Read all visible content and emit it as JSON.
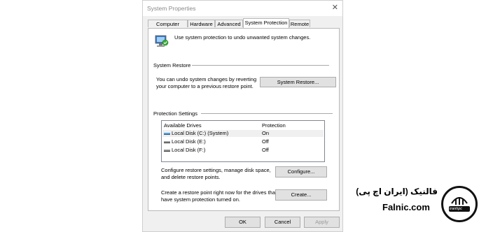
{
  "window": {
    "title": "System Properties"
  },
  "tabs": [
    {
      "label": "Computer Name",
      "active": false
    },
    {
      "label": "Hardware",
      "active": false
    },
    {
      "label": "Advanced",
      "active": false
    },
    {
      "label": "System Protection",
      "active": true
    },
    {
      "label": "Remote",
      "active": false
    }
  ],
  "intro": {
    "text": "Use system protection to undo unwanted system changes."
  },
  "system_restore": {
    "heading": "System Restore",
    "desc_line1": "You can undo system changes by reverting",
    "desc_line2": "your computer to a previous restore point.",
    "button": "System Restore..."
  },
  "protection": {
    "heading": "Protection Settings",
    "col_drives": "Available Drives",
    "col_protection": "Protection",
    "drives": [
      {
        "name": "Local Disk (C:) (System)",
        "protection": "On",
        "icon": "system-drive-icon"
      },
      {
        "name": "Local Disk (E:)",
        "protection": "Off",
        "icon": "drive-icon"
      },
      {
        "name": "Local Disk (F:)",
        "protection": "Off",
        "icon": "drive-icon"
      }
    ],
    "configure_line1": "Configure restore settings, manage disk space,",
    "configure_line2": "and delete restore points.",
    "configure_button": "Configure...",
    "create_line1": "Create a restore point right now for the drives that",
    "create_line2": "have system protection turned on.",
    "create_button": "Create..."
  },
  "footer": {
    "ok": "OK",
    "cancel": "Cancel",
    "apply": "Apply"
  },
  "watermark": {
    "line1": "فالنیک (ایران اچ پی)",
    "line2": "Falnic.com",
    "logo_text": "iranhpc"
  },
  "colors": {
    "window_bg": "#f0f0f0",
    "panel_bg": "#ffffff",
    "button_bg": "#e1e1e1",
    "border": "#adadad"
  }
}
